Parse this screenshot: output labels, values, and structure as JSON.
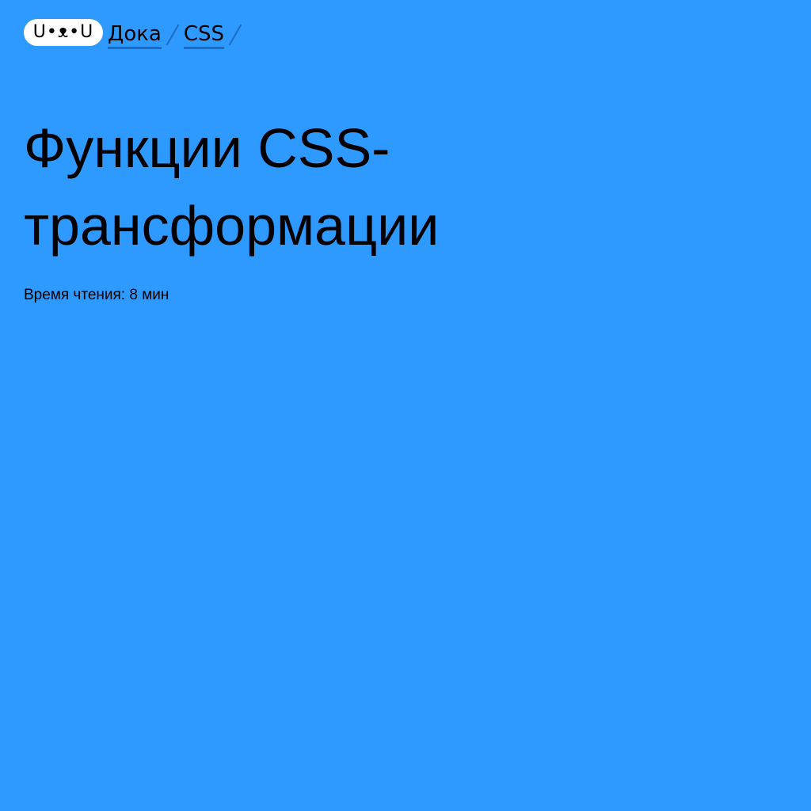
{
  "header": {
    "logo_text": "U•ᴥ•U",
    "breadcrumbs": [
      {
        "label": "Дока"
      },
      {
        "label": "CSS"
      }
    ]
  },
  "article": {
    "title": "Функции CSS-трансформации",
    "reading_time": "Время чтения: 8 мин"
  },
  "colors": {
    "background": "#2e99ff",
    "logo_background": "#ffffff",
    "link_underline": "#1f6bc2",
    "text": "#000000"
  }
}
